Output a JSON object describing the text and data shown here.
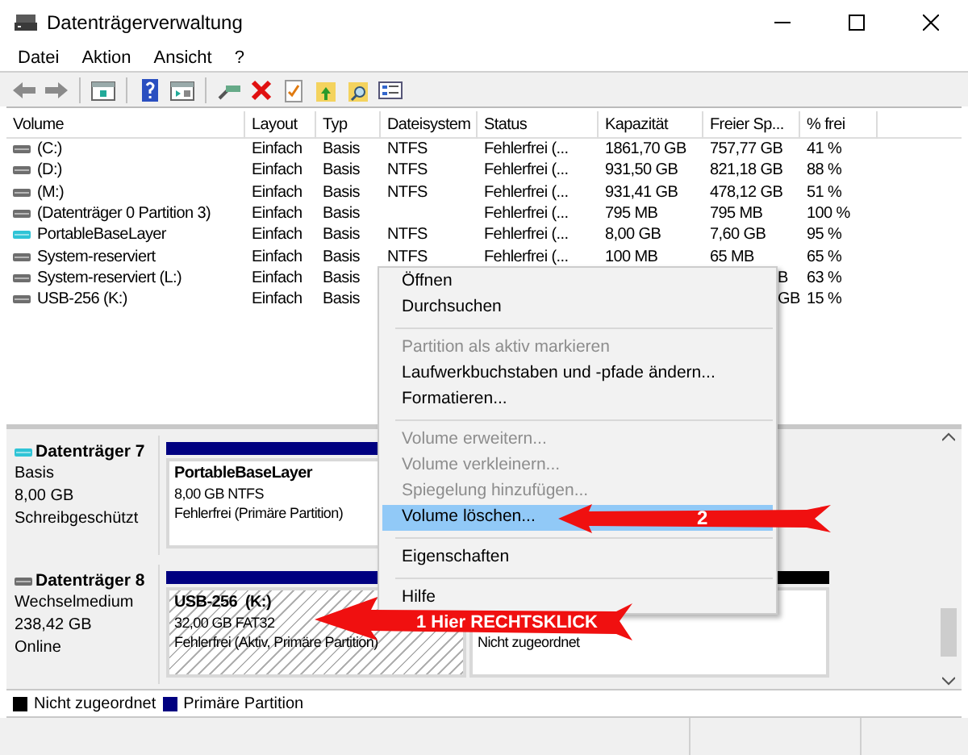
{
  "window": {
    "title": "Datenträgerverwaltung"
  },
  "menu": [
    "Datei",
    "Aktion",
    "Ansicht",
    "?"
  ],
  "table": {
    "columns": [
      "Volume",
      "Layout",
      "Typ",
      "Dateisystem",
      "Status",
      "Kapazität",
      "Freier Sp...",
      "% frei"
    ],
    "rows": [
      {
        "color": "#6e6e6e",
        "covered": false,
        "volume": "(C:)",
        "layout": "Einfach",
        "typ": "Basis",
        "dateisystem": "NTFS",
        "status": "Fehlerfrei (...",
        "kapazitaet": "1861,70 GB",
        "freier_speicher": "757,77 GB",
        "prozent_frei": "41 %"
      },
      {
        "color": "#6e6e6e",
        "covered": false,
        "volume": "(D:)",
        "layout": "Einfach",
        "typ": "Basis",
        "dateisystem": "NTFS",
        "status": "Fehlerfrei (...",
        "kapazitaet": "931,50 GB",
        "freier_speicher": "821,18 GB",
        "prozent_frei": "88 %"
      },
      {
        "color": "#6e6e6e",
        "covered": false,
        "volume": "(M:)",
        "layout": "Einfach",
        "typ": "Basis",
        "dateisystem": "NTFS",
        "status": "Fehlerfrei (...",
        "kapazitaet": "931,41 GB",
        "freier_speicher": "478,12 GB",
        "prozent_frei": "51 %"
      },
      {
        "color": "#6e6e6e",
        "covered": false,
        "volume": "(Datenträger 0 Partition 3)",
        "layout": "Einfach",
        "typ": "Basis",
        "status": "Fehlerfrei (...",
        "kapazitaet": "795 MB",
        "freier_speicher": "795 MB",
        "prozent_frei": "100 %"
      },
      {
        "color": "#2fc4d6",
        "covered": false,
        "volume": "PortableBaseLayer",
        "layout": "Einfach",
        "typ": "Basis",
        "dateisystem": "NTFS",
        "status": "Fehlerfrei (...",
        "kapazitaet": "8,00 GB",
        "freier_speicher": "7,60 GB",
        "prozent_frei": "95 %"
      },
      {
        "color": "#6e6e6e",
        "covered": false,
        "volume": "System-reserviert",
        "layout": "Einfach",
        "typ": "Basis",
        "dateisystem": "NTFS",
        "status": "Fehlerfrei (...",
        "kapazitaet": "100 MB",
        "freier_speicher": "65 MB",
        "prozent_frei": "65 %"
      },
      {
        "color": "#6e6e6e",
        "covered": true,
        "volume": "System-reserviert (L:)",
        "layout": "Einfach",
        "typ": "Basis",
        "freier_speicher": "B",
        "prozent_frei": "63 %"
      },
      {
        "color": "#6e6e6e",
        "covered": true,
        "volume": "USB-256 (K:)",
        "layout": "Einfach",
        "typ": "Basis",
        "freier_speicher": "GB",
        "prozent_frei": "15 %"
      }
    ]
  },
  "disks": [
    {
      "name": "Datenträger 7",
      "color": "#2fc4d6",
      "lines": [
        "Basis",
        "8,00 GB",
        "Schreibgeschützt"
      ],
      "partitions": [
        {
          "kind": "primary",
          "hatched": false,
          "name": "PortableBaseLayer",
          "lines": [
            "8,00 GB NTFS",
            "Fehlerfrei (Primäre Partition)"
          ]
        }
      ]
    },
    {
      "name": "Datenträger 8",
      "color": "#6e6e6e",
      "lines": [
        "Wechselmedium",
        "238,42 GB",
        "Online"
      ],
      "partitions": [
        {
          "kind": "primary",
          "hatched": true,
          "name": "USB-256  (K:)",
          "lines": [
            "32,00 GB FAT32",
            "Fehlerfrei (Aktiv, Primäre Partition)"
          ]
        },
        {
          "kind": "unallocated",
          "hatched": false,
          "lines": [
            "Nicht zugeordnet"
          ]
        }
      ]
    }
  ],
  "legend": [
    {
      "label": "Nicht zugeordnet",
      "color": "#000000"
    },
    {
      "label": "Primäre Partition",
      "color": "#000080"
    }
  ],
  "context_menu": [
    {
      "kind": "item",
      "label": "Öffnen",
      "disabled": false,
      "selected": false
    },
    {
      "kind": "item",
      "label": "Durchsuchen",
      "disabled": false,
      "selected": false
    },
    {
      "kind": "separator"
    },
    {
      "kind": "item",
      "label": "Partition als aktiv markieren",
      "disabled": true,
      "selected": false
    },
    {
      "kind": "item",
      "label": "Laufwerkbuchstaben und -pfade ändern...",
      "disabled": false,
      "selected": false
    },
    {
      "kind": "item",
      "label": "Formatieren...",
      "disabled": false,
      "selected": false
    },
    {
      "kind": "separator"
    },
    {
      "kind": "item",
      "label": "Volume erweitern...",
      "disabled": true,
      "selected": false
    },
    {
      "kind": "item",
      "label": "Volume verkleinern...",
      "disabled": true,
      "selected": false
    },
    {
      "kind": "item",
      "label": "Spiegelung hinzufügen...",
      "disabled": true,
      "selected": false
    },
    {
      "kind": "item",
      "label": "Volume löschen...",
      "disabled": false,
      "selected": true
    },
    {
      "kind": "separator"
    },
    {
      "kind": "item",
      "label": "Eigenschaften",
      "disabled": false,
      "selected": false
    },
    {
      "kind": "separator"
    },
    {
      "kind": "item",
      "label": "Hilfe",
      "disabled": false,
      "selected": false
    }
  ],
  "annotations": [
    {
      "label": "2"
    },
    {
      "label": "1 Hier RECHTSKLICK"
    }
  ]
}
